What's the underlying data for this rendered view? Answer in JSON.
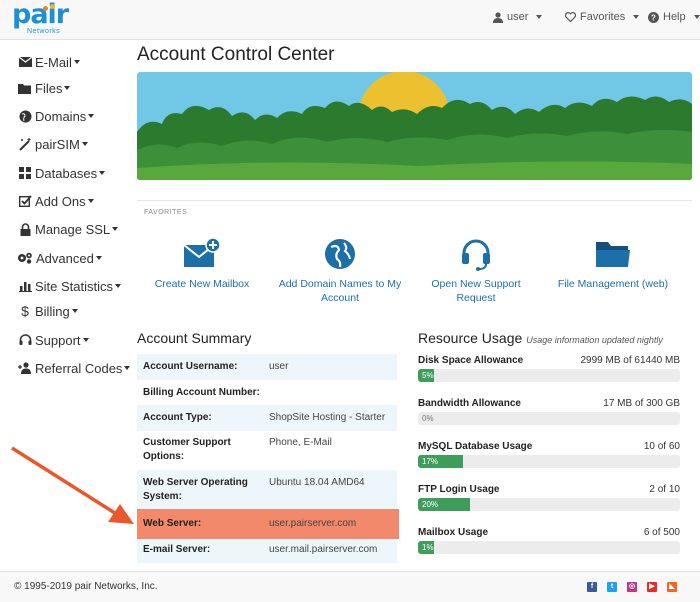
{
  "brand": {
    "name": "pair",
    "sub": "Networks"
  },
  "topnav": {
    "user_label": "user",
    "favorites_label": "Favorites",
    "help_label": "Help"
  },
  "sidebar": {
    "items": [
      {
        "label": "E-Mail",
        "icon": "envelope-icon"
      },
      {
        "label": "Files",
        "icon": "folder-icon"
      },
      {
        "label": "Domains",
        "icon": "globe-icon"
      },
      {
        "label": "pairSIM",
        "icon": "magic-wand-icon"
      },
      {
        "label": "Databases",
        "icon": "grid-icon"
      },
      {
        "label": "Add Ons",
        "icon": "checkbox-icon"
      },
      {
        "label": "Manage SSL",
        "icon": "lock-icon"
      },
      {
        "label": "Advanced",
        "icon": "gears-icon"
      },
      {
        "label": "Site Statistics",
        "icon": "bar-chart-icon"
      },
      {
        "label": "Billing",
        "icon": "dollar-icon"
      },
      {
        "label": "Support",
        "icon": "headset-icon"
      },
      {
        "label": "Referral Codes",
        "icon": "user-add-icon"
      }
    ]
  },
  "main": {
    "title": "Account Control Center",
    "favorites": {
      "heading": "FAVORITES",
      "items": [
        {
          "label": "Create New Mailbox",
          "icon": "envelope-plus-icon"
        },
        {
          "label": "Add Domain Names to My Account",
          "icon": "globe-icon"
        },
        {
          "label": "Open New Support Request",
          "icon": "headset-icon"
        },
        {
          "label": "File Management (web)",
          "icon": "folder-icon"
        }
      ]
    }
  },
  "account_summary": {
    "title": "Account Summary",
    "rows": [
      {
        "key": "Account Username:",
        "value": "user"
      },
      {
        "key": "Billing Account Number:",
        "value": ""
      },
      {
        "key": "Account Type:",
        "value": "ShopSite Hosting - Starter"
      },
      {
        "key": "Customer Support Options:",
        "value": "Phone, E-Mail"
      },
      {
        "key": "Web Server Operating System:",
        "value": "Ubuntu 18.04 AMD64"
      },
      {
        "key": "Web Server:",
        "value": "user.pairserver.com"
      },
      {
        "key": "E-mail Server:",
        "value": "user.mail.pairserver.com"
      }
    ]
  },
  "resource_usage": {
    "title": "Resource Usage",
    "subtitle": "Usage information updated nightly",
    "items": [
      {
        "label": "Disk Space Allowance",
        "value": "2999 MB of 61440 MB",
        "percent": "5%",
        "fraction": 0.05
      },
      {
        "label": "Bandwidth Allowance",
        "value": "17 MB of 300 GB",
        "percent": "0%",
        "fraction": 0.0
      },
      {
        "label": "MySQL Database Usage",
        "value": "10 of 60",
        "percent": "17%",
        "fraction": 0.17
      },
      {
        "label": "FTP Login Usage",
        "value": "2 of 10",
        "percent": "20%",
        "fraction": 0.2
      },
      {
        "label": "Mailbox Usage",
        "value": "6 of 500",
        "percent": "1%",
        "fraction": 0.01
      }
    ]
  },
  "footer": {
    "copyright": "© 1995-2019 pair Networks, Inc.",
    "social": [
      "facebook-icon",
      "twitter-icon",
      "instagram-icon",
      "youtube-icon",
      "rss-icon"
    ]
  },
  "colors": {
    "accent": "#1d8fd6",
    "link": "#1a6fb0",
    "highlight": "#f2896a",
    "progress": "#3f9d5c",
    "arrow": "#e8582a"
  }
}
